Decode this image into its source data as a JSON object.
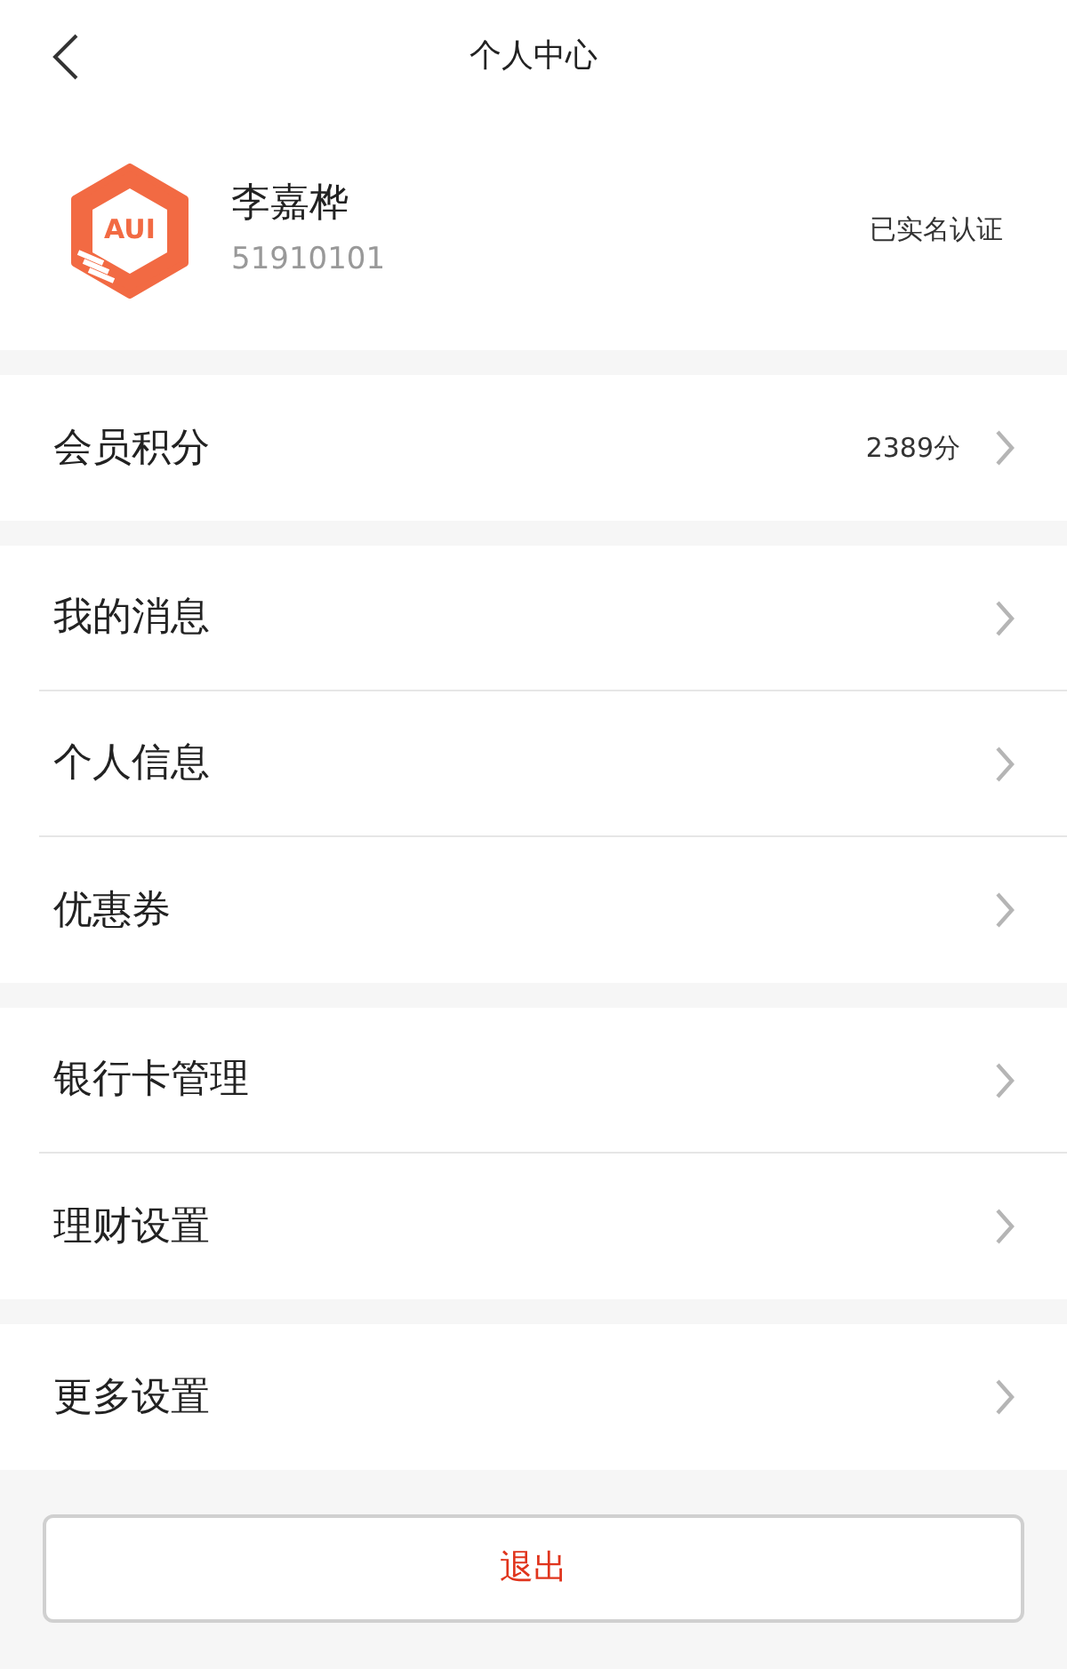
{
  "header": {
    "title": "个人中心"
  },
  "profile": {
    "logo_text": "AUI",
    "name": "李嘉桦",
    "id": "51910101",
    "status": "已实名认证"
  },
  "groups": [
    {
      "items": [
        {
          "label": "会员积分",
          "value": "2389分"
        }
      ]
    },
    {
      "items": [
        {
          "label": "我的消息"
        },
        {
          "label": "个人信息"
        },
        {
          "label": "优惠券"
        }
      ]
    },
    {
      "items": [
        {
          "label": "银行卡管理"
        },
        {
          "label": "理财设置"
        }
      ]
    },
    {
      "items": [
        {
          "label": "更多设置"
        }
      ]
    }
  ],
  "logout_button": "退出"
}
